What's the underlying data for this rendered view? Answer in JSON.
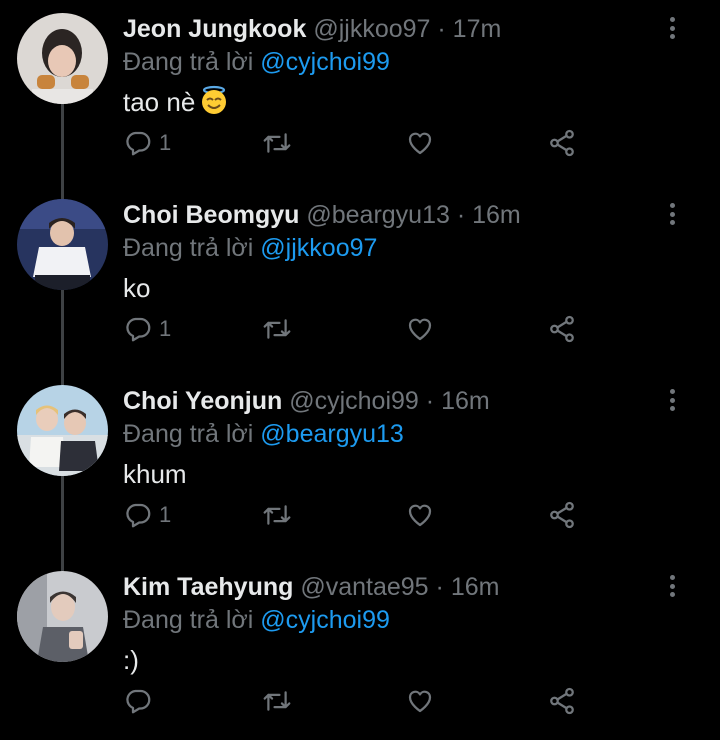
{
  "tweets": [
    {
      "name": "Jeon Jungkook",
      "handle": "@jjkkoo97",
      "sep": "·",
      "time": "17m",
      "reply_prefix": "Đang trả lời",
      "reply_to": "@cyjchoi99",
      "text": "tao nè",
      "emoji": "smiling-face-with-halo",
      "reply_count": "1",
      "avatar_colors": [
        "#d8d4d0",
        "#b8a49a"
      ]
    },
    {
      "name": "Choi Beomgyu",
      "handle": "@beargyu13",
      "sep": "·",
      "time": "16m",
      "reply_prefix": "Đang trả lời",
      "reply_to": "@jjkkoo97",
      "text": "ko",
      "reply_count": "1",
      "avatar_colors": [
        "#2e3b6e",
        "#e9ecf2"
      ]
    },
    {
      "name": "Choi Yeonjun",
      "handle": "@cyjchoi99",
      "sep": "·",
      "time": "16m",
      "reply_prefix": "Đang trả lời",
      "reply_to": "@beargyu13",
      "text": "khum",
      "reply_count": "1",
      "avatar_colors": [
        "#a9cbe3",
        "#c9d8e2"
      ]
    },
    {
      "name": "Kim Taehyung",
      "handle": "@vantae95",
      "sep": "·",
      "time": "16m",
      "reply_prefix": "Đang trả lời",
      "reply_to": "@cyjchoi99",
      "text": ":)",
      "reply_count": "",
      "avatar_colors": [
        "#8c8f96",
        "#cfd1d5"
      ]
    }
  ],
  "colors": {
    "background": "#000000",
    "text_primary": "#e7e9ea",
    "text_secondary": "#71767b",
    "link": "#1d9bf0",
    "thread_line": "#3e4144"
  }
}
